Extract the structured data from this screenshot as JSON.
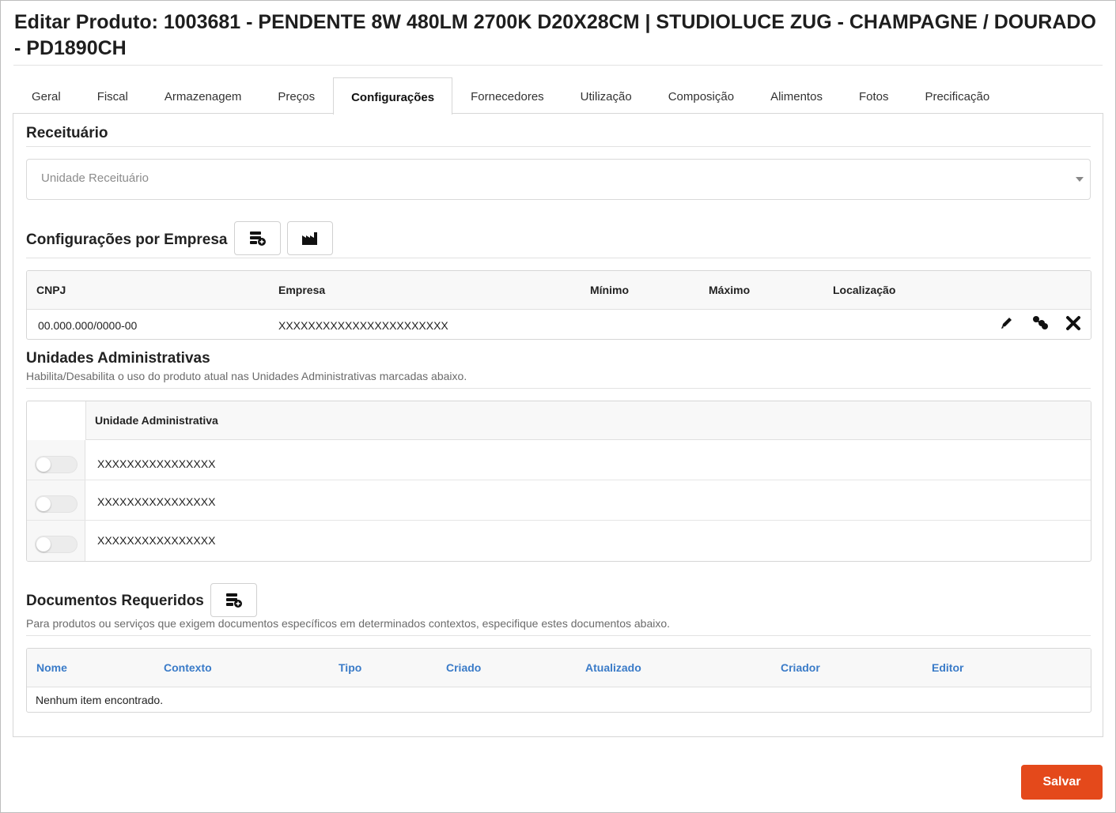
{
  "page": {
    "title": "Editar Produto: 1003681 - PENDENTE 8W 480LM 2700K D20X28CM | STUDIOLUCE ZUG - CHAMPAGNE / DOURADO - PD1890CH"
  },
  "tabs": [
    {
      "label": "Geral",
      "active": false
    },
    {
      "label": "Fiscal",
      "active": false
    },
    {
      "label": "Armazenagem",
      "active": false
    },
    {
      "label": "Preços",
      "active": false
    },
    {
      "label": "Configurações",
      "active": true
    },
    {
      "label": "Fornecedores",
      "active": false
    },
    {
      "label": "Utilização",
      "active": false
    },
    {
      "label": "Composição",
      "active": false
    },
    {
      "label": "Alimentos",
      "active": false
    },
    {
      "label": "Fotos",
      "active": false
    },
    {
      "label": "Precificação",
      "active": false
    }
  ],
  "receituario": {
    "title": "Receituário",
    "select_placeholder": "Unidade Receituário"
  },
  "config_empresa": {
    "title": "Configurações por Empresa",
    "add_button_icon": "add-list-icon",
    "factory_button_icon": "factory-icon",
    "columns": [
      "CNPJ",
      "Empresa",
      "Mínimo",
      "Máximo",
      "Localização"
    ],
    "rows": [
      {
        "cnpj": "00.000.000/0000-00",
        "empresa": "XXXXXXXXXXXXXXXXXXXXXXX",
        "minimo": "",
        "maximo": "",
        "localizacao": ""
      }
    ],
    "row_action_icons": [
      "pencil-icon",
      "link-icon",
      "close-icon"
    ]
  },
  "unidades": {
    "title": "Unidades Administrativas",
    "description": "Habilita/Desabilita o uso do produto atual nas Unidades Administrativas marcadas abaixo.",
    "column": "Unidade Administrativa",
    "rows": [
      {
        "name": "XXXXXXXXXXXXXXXX",
        "enabled": false
      },
      {
        "name": "XXXXXXXXXXXXXXXX",
        "enabled": false
      },
      {
        "name": "XXXXXXXXXXXXXXXX",
        "enabled": false
      }
    ]
  },
  "documentos": {
    "title": "Documentos Requeridos",
    "add_button_icon": "add-list-icon",
    "description": "Para produtos ou serviços que exigem documentos específicos em determinados contextos, especifique estes documentos abaixo.",
    "columns": [
      "Nome",
      "Contexto",
      "Tipo",
      "Criado",
      "Atualizado",
      "Criador",
      "Editor"
    ],
    "empty_text": "Nenhum item encontrado."
  },
  "footer": {
    "save_label": "Salvar",
    "save_color": "#e4491b"
  },
  "colors": {
    "link": "#3a7bc8",
    "border": "#d6d6d6"
  }
}
